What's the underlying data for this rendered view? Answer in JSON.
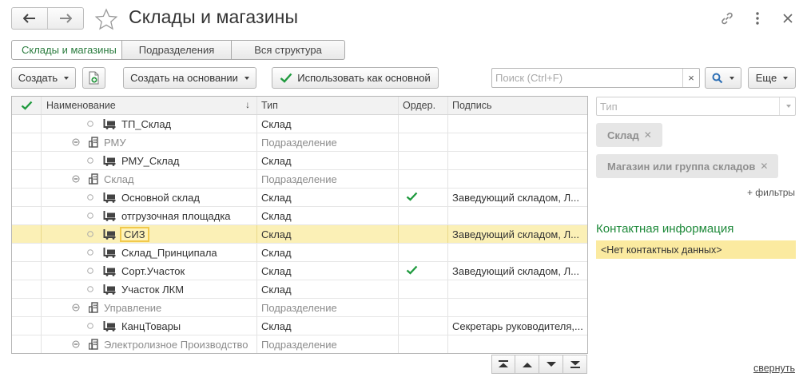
{
  "window": {
    "title": "Склады и магазины"
  },
  "tabs": [
    {
      "label": "Склады и магазины",
      "active": true
    },
    {
      "label": "Подразделения",
      "active": false
    },
    {
      "label": "Вся структура",
      "active": false
    }
  ],
  "toolbar": {
    "create_label": "Создать",
    "create_based_label": "Создать на основании",
    "use_as_main_label": "Использовать как основной",
    "search_placeholder": "Поиск (Ctrl+F)",
    "more_label": "Еще"
  },
  "table": {
    "columns": [
      "Наименование",
      "Тип",
      "Ордер.",
      "Подпись"
    ],
    "rows": [
      {
        "name": "ТП_Склад",
        "type": "Склад",
        "order": false,
        "sign": "",
        "kind": "warehouse",
        "level": 1,
        "selected": false
      },
      {
        "name": "РМУ",
        "type": "Подразделение",
        "order": false,
        "sign": "",
        "kind": "group",
        "level": 0,
        "selected": false
      },
      {
        "name": "РМУ_Склад",
        "type": "Склад",
        "order": false,
        "sign": "",
        "kind": "warehouse",
        "level": 1,
        "selected": false
      },
      {
        "name": "Склад",
        "type": "Подразделение",
        "order": false,
        "sign": "",
        "kind": "group",
        "level": 0,
        "selected": false
      },
      {
        "name": "Основной склад",
        "type": "Склад",
        "order": true,
        "sign": "Заведующий складом, Л...",
        "kind": "warehouse",
        "level": 1,
        "selected": false
      },
      {
        "name": "отгрузочная площадка",
        "type": "Склад",
        "order": false,
        "sign": "",
        "kind": "warehouse",
        "level": 1,
        "selected": false
      },
      {
        "name": "СИЗ",
        "type": "Склад",
        "order": false,
        "sign": "Заведующий складом, Л...",
        "kind": "warehouse",
        "level": 1,
        "selected": true
      },
      {
        "name": "Склад_Принципала",
        "type": "Склад",
        "order": false,
        "sign": "",
        "kind": "warehouse",
        "level": 1,
        "selected": false
      },
      {
        "name": "Сорт.Участок",
        "type": "Склад",
        "order": true,
        "sign": "Заведующий складом, Л...",
        "kind": "warehouse",
        "level": 1,
        "selected": false
      },
      {
        "name": "Участок ЛКМ",
        "type": "Склад",
        "order": false,
        "sign": "",
        "kind": "warehouse",
        "level": 1,
        "selected": false
      },
      {
        "name": "Управление",
        "type": "Подразделение",
        "order": false,
        "sign": "",
        "kind": "group",
        "level": 0,
        "selected": false
      },
      {
        "name": "КанцТовары",
        "type": "Склад",
        "order": false,
        "sign": "Секретарь руководителя,...",
        "kind": "warehouse",
        "level": 1,
        "selected": false
      },
      {
        "name": "Электролизное Производство",
        "type": "Подразделение",
        "order": false,
        "sign": "",
        "kind": "group",
        "level": 0,
        "selected": false
      }
    ]
  },
  "filters": {
    "type_placeholder": "Тип",
    "tags": [
      "Склад",
      "Магазин или группа складов"
    ],
    "add_filters_label": "+ фильтры"
  },
  "contacts": {
    "title": "Контактная информация",
    "empty_text": "<Нет контактных данных>"
  },
  "collapse_label": "свернуть",
  "colors": {
    "accent_green": "#1f8a3b",
    "selection": "#fbf0b6",
    "contact_bg": "#fbeaa0"
  }
}
